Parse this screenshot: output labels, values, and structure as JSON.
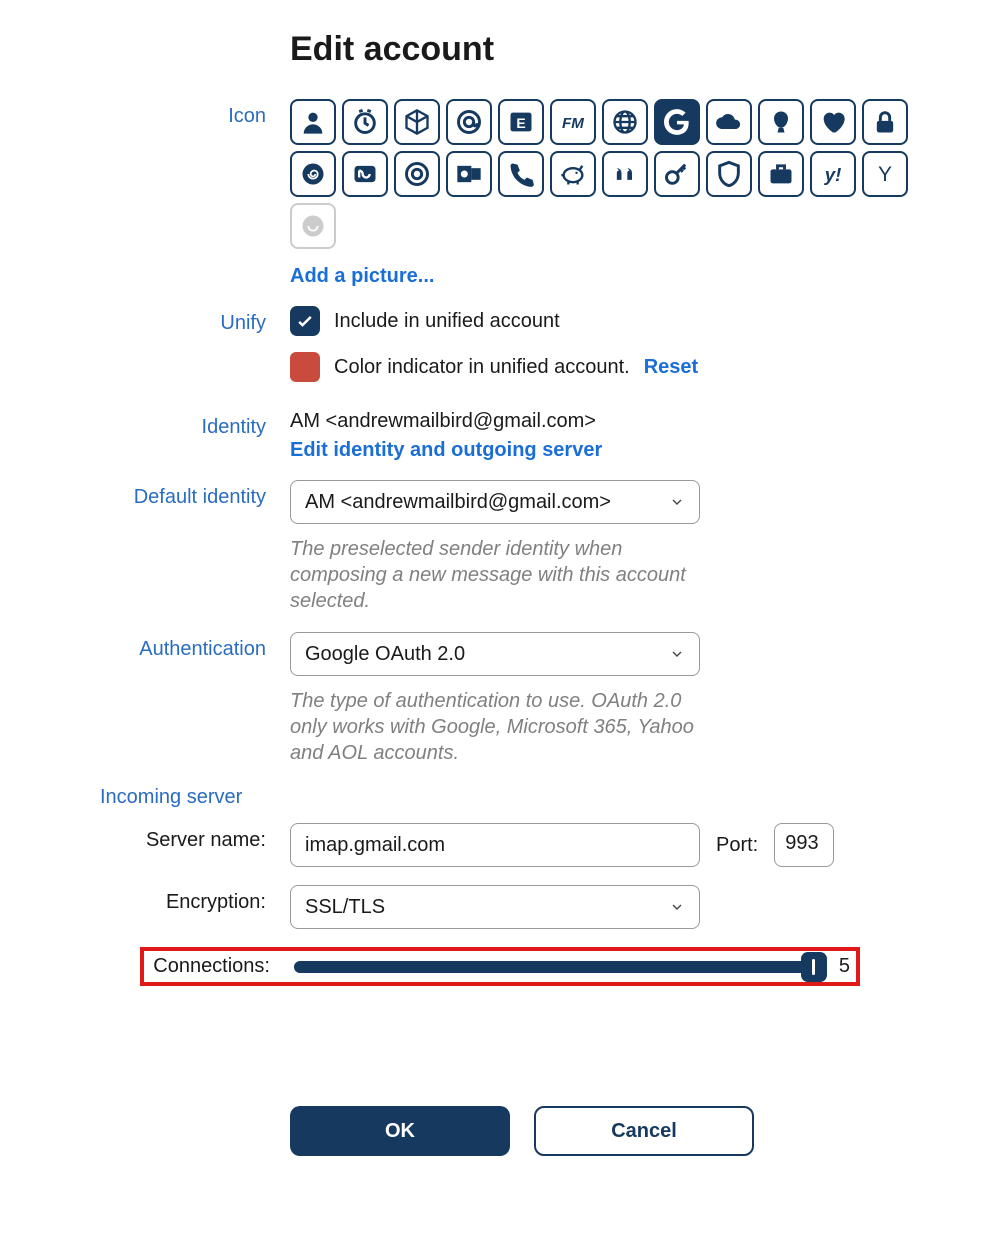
{
  "title": "Edit account",
  "labels": {
    "icon": "Icon",
    "unify": "Unify",
    "identity": "Identity",
    "default_identity": "Default identity",
    "authentication": "Authentication",
    "incoming_server": "Incoming server",
    "server_name": "Server name:",
    "encryption": "Encryption:",
    "connections": "Connections:",
    "port": "Port:"
  },
  "icons": {
    "add_picture": "Add a picture..."
  },
  "unify": {
    "include_label": "Include in unified account",
    "color_label": "Color indicator in unified account.",
    "reset": "Reset",
    "include_checked": true,
    "color": "#c94b3d"
  },
  "identity": {
    "value": "AM <andrewmailbird@gmail.com>",
    "edit_link": "Edit identity and outgoing server"
  },
  "default_identity": {
    "selected": "AM <andrewmailbird@gmail.com>",
    "helper": "The preselected sender identity when composing a new message with this account selected."
  },
  "authentication": {
    "selected": "Google OAuth 2.0",
    "helper": "The type of authentication to use. OAuth 2.0 only works with Google, Microsoft 365, Yahoo and AOL accounts."
  },
  "incoming": {
    "server_name": "imap.gmail.com",
    "port": "993",
    "encryption": "SSL/TLS",
    "connections": "5"
  },
  "buttons": {
    "ok": "OK",
    "cancel": "Cancel"
  }
}
